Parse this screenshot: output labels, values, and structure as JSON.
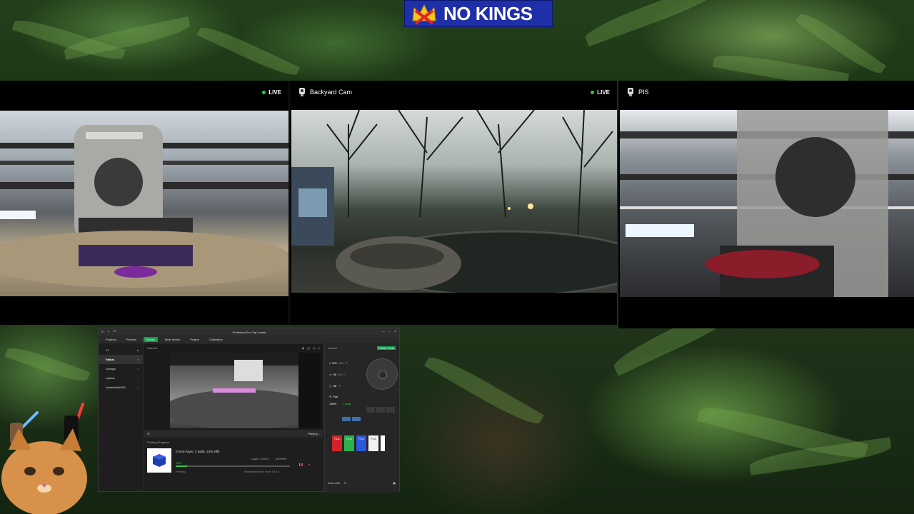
{
  "logo": {
    "text": "NO KINGS"
  },
  "cameras": [
    {
      "title": "",
      "live_label": "LIVE"
    },
    {
      "title": "Backyard Cam",
      "live_label": "LIVE"
    },
    {
      "title": "PIS",
      "live_label": ""
    }
  ],
  "studio": {
    "window_title": "Printerbox Eco Top Loader",
    "tabs": [
      "Projects",
      "Preview",
      "Device",
      "Multi-device",
      "Project",
      "Calibration"
    ],
    "active_tab": "Device",
    "printer_name": "X1",
    "sidebar": [
      "Status",
      "Storage",
      "Update",
      "Assistant(HMS)"
    ],
    "camera_label": "Camera",
    "playing_label": "Playing...",
    "control_label": "Control",
    "printer_parts_button": "Printer Parts",
    "temps": [
      {
        "value": "220",
        "target": "/220 °C"
      },
      {
        "value": "55",
        "target": "/55 °C"
      },
      {
        "value": "38",
        "target": "°C"
      }
    ],
    "fan_label": "Fan",
    "fan_value": "100%",
    "lamp_label": "Lamp",
    "progress_heading": "Printing Progress",
    "job_desc": "0.2mm layer, 2 walls, 10% infill",
    "layer_info": "Layer: 10/102",
    "time_remaining": "-1h00min",
    "progress_percent": "10%",
    "progress_fraction": 0.1,
    "status": "Printing",
    "finish_time": "Estimated finish time: 04:19",
    "filaments": [
      {
        "label": "PLA",
        "color": "#d2232a"
      },
      {
        "label": "PLA",
        "color": "#2bb24c"
      },
      {
        "label": "PLA",
        "color": "#2c59d8"
      },
      {
        "label": "PLA",
        "color": "#f2f2f2"
      }
    ],
    "auto_refill": "Auto-refill"
  }
}
